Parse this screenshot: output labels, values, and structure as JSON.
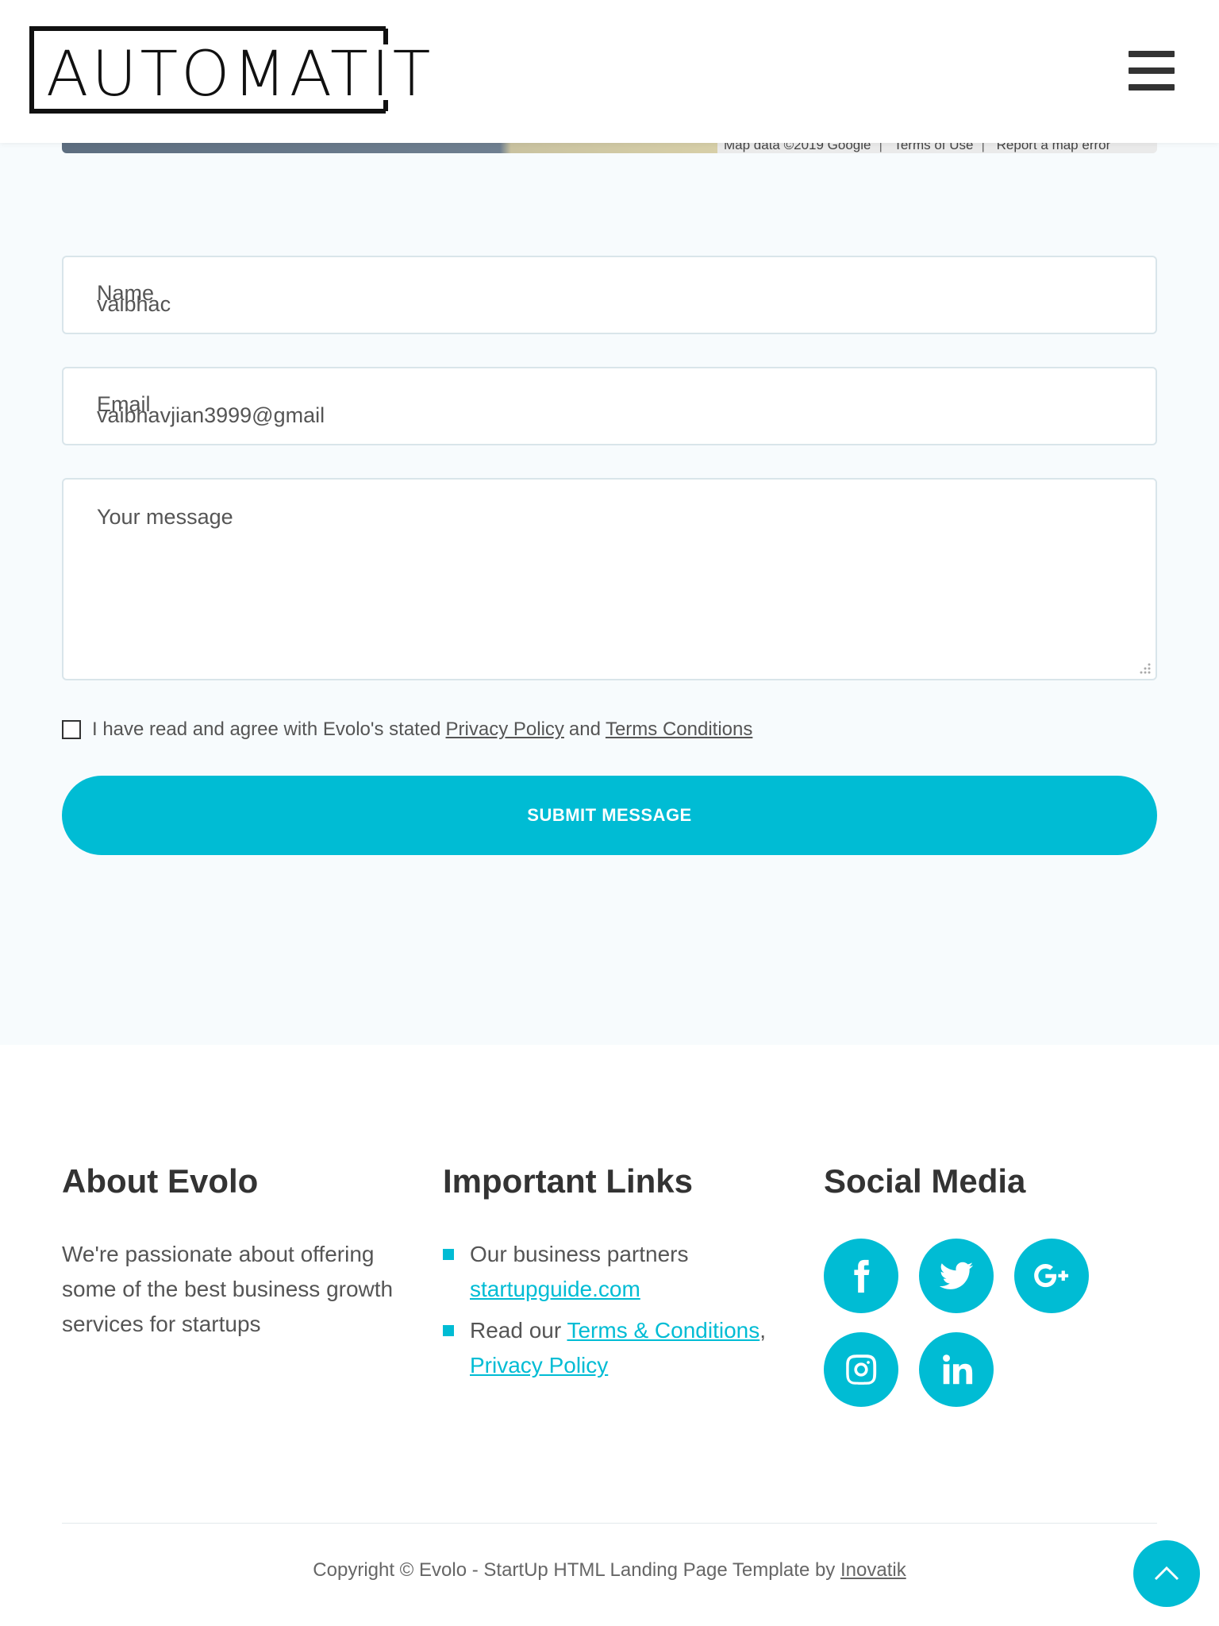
{
  "header": {
    "logo_text": "AUTOMATIT",
    "menu_icon": "hamburger-icon"
  },
  "map": {
    "attribution": [
      "Map data ©2019 Google",
      "Terms of Use",
      "Report a map error"
    ]
  },
  "form": {
    "name_label": "Name",
    "name_value": "vaibhac",
    "email_label": "Email",
    "email_value": "vaibhavjian3999@gmail",
    "message_placeholder": "Your message",
    "agree_text": "I have read and agree with Evolo's stated",
    "privacy_link": "Privacy Policy",
    "and_text": "and",
    "terms_link": "Terms Conditions",
    "submit_label": "SUBMIT MESSAGE"
  },
  "footer": {
    "about": {
      "title": "About Evolo",
      "text": "We're passionate about offering some of the best business growth services for startups"
    },
    "links": {
      "title": "Important Links",
      "item1_text": "Our business partners",
      "item1_link": "startupguide.com",
      "item2_text": "Read our",
      "item2_link1": "Terms & Conditions",
      "item2_comma": ",",
      "item2_link2": "Privacy Policy"
    },
    "social": {
      "title": "Social Media",
      "icons": [
        "facebook-icon",
        "twitter-icon",
        "google-plus-icon",
        "instagram-icon",
        "linkedin-icon"
      ]
    },
    "copyright_text": "Copyright © Evolo - StartUp HTML Landing Page Template by",
    "copyright_link": "Inovatik"
  },
  "colors": {
    "accent": "#00bcd4",
    "background": "#f7fbfd",
    "text": "#333333"
  }
}
